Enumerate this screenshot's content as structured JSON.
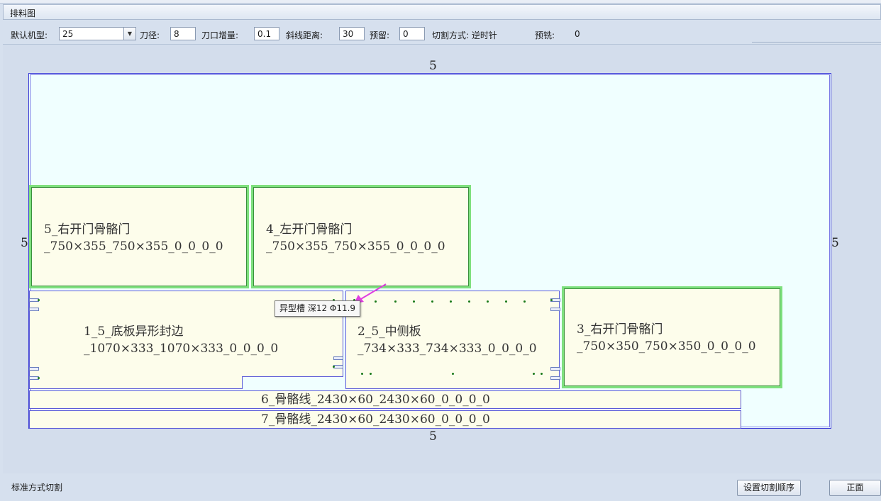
{
  "tab": {
    "title": "排料图"
  },
  "toolbar": {
    "machine_label": "默认机型:",
    "machine_value": "25",
    "knife_label": "刀径:",
    "knife_value": "8",
    "kerf_label": "刀口增量:",
    "kerf_value": "0.1",
    "slant_label": "斜线距离:",
    "slant_value": "30",
    "reserve_label": "预留:",
    "reserve_value": "0",
    "cut_mode_label": "切割方式: 逆时针",
    "premill_label": "预铣:",
    "premill_value": "0"
  },
  "board": {
    "margin_top": "5",
    "margin_bottom": "5",
    "margin_left": "5",
    "margin_right": "5"
  },
  "parts": [
    {
      "line1": "5_右开门骨骼门",
      "line2": "_750×355_750×355_0_0_0_0"
    },
    {
      "line1": "4_左开门骨骼门",
      "line2": "_750×355_750×355_0_0_0_0"
    },
    {
      "line1": "1_5_底板异形封边",
      "line2": "_1070×333_1070×333_0_0_0_0"
    },
    {
      "line1": "2_5_中侧板",
      "line2": "_734×333_734×333_0_0_0_0"
    },
    {
      "line1": "3_右开门骨骼门",
      "line2": "_750×350_750×350_0_0_0_0"
    },
    {
      "line1": "6_骨骼线_2430×60_2430×60_0_0_0_0"
    },
    {
      "line1": "7_骨骼线_2430×60_2430×60_0_0_0_0"
    }
  ],
  "tooltip": "异型槽 深12 Φ11.9",
  "status": "标准方式切割",
  "buttons": {
    "set_order": "设置切割顺序",
    "front": "正面"
  },
  "colors": {
    "board_fill": "#f0ffff",
    "part_fill": "#fdfdeb",
    "door_border": "#7ee07e",
    "arrow": "#e040e0",
    "drill_dot": "#1a7a1a"
  }
}
